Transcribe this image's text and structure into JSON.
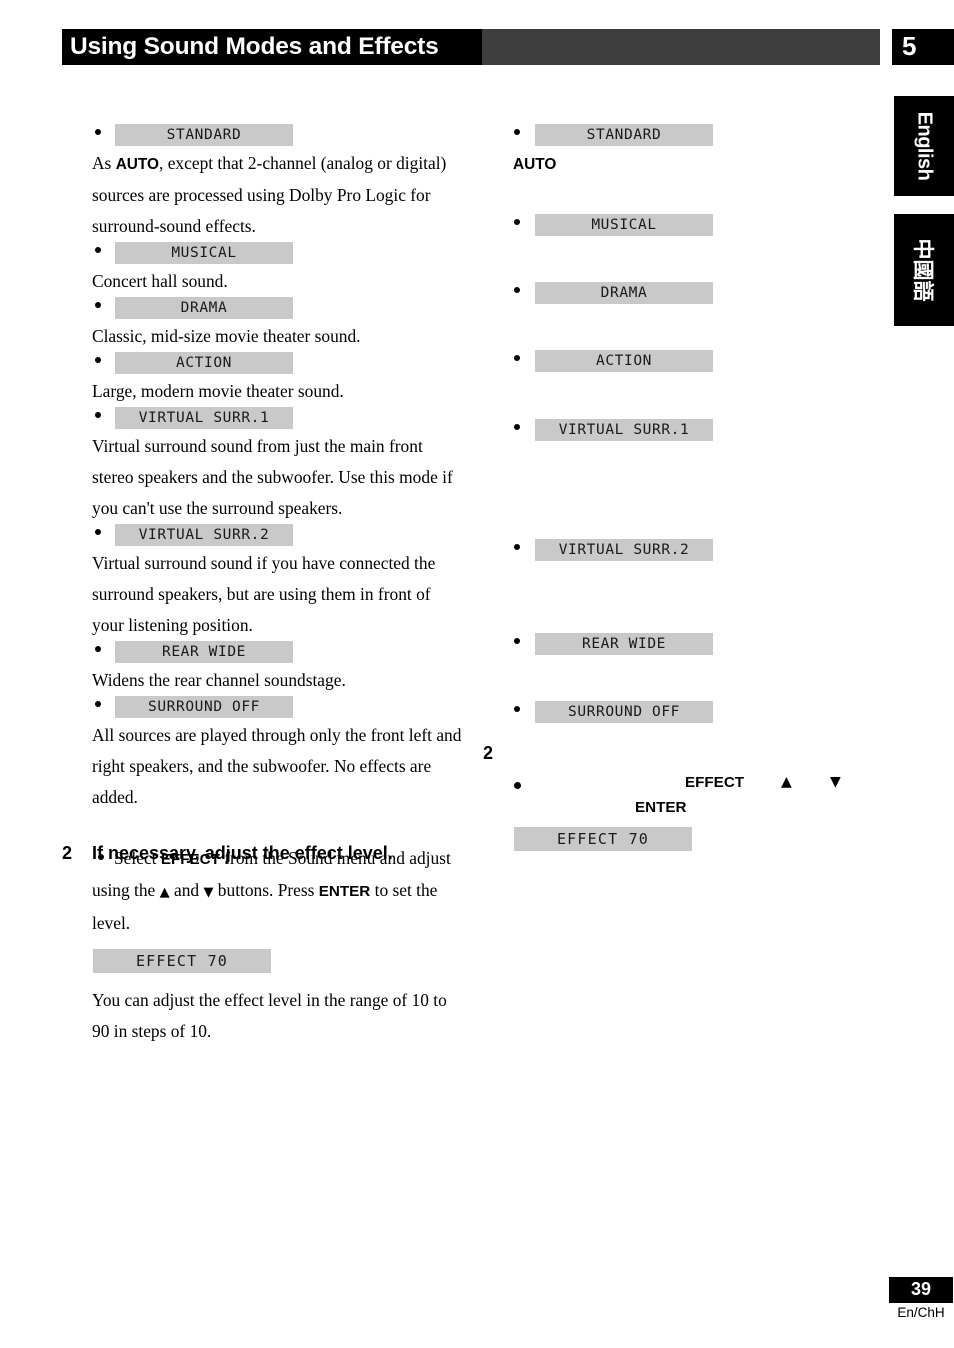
{
  "header": {
    "title": "Using Sound Modes and Effects",
    "chapter_number": "5"
  },
  "side_tabs": [
    {
      "label": "English"
    },
    {
      "label": "中國語"
    }
  ],
  "left_column": {
    "modes": [
      {
        "box_label": "STANDARD",
        "description_html": "As <b>AUTO</b>, except that 2-channel (analog or digital) sources are processed using Dolby Pro Logic for surround-sound effects."
      },
      {
        "box_label": "MUSICAL",
        "description_html": "Concert hall sound."
      },
      {
        "box_label": "DRAMA",
        "description_html": "Classic, mid-size movie theater sound."
      },
      {
        "box_label": "ACTION",
        "description_html": "Large, modern movie theater sound."
      },
      {
        "box_label": "VIRTUAL SURR.1",
        "description_html": "Virtual surround sound from just the main front stereo speakers and the subwoofer. Use this mode if you can't use the surround speakers."
      },
      {
        "box_label": "VIRTUAL SURR.2",
        "description_html": "Virtual surround sound if you have connected the surround speakers, but are using them in front of your listening position."
      },
      {
        "box_label": "REAR WIDE",
        "description_html": "Widens the rear channel soundstage."
      },
      {
        "box_label": "SURROUND OFF",
        "description_html": "All sources are played through only the front left and right speakers, and the subwoofer. No effects are added."
      }
    ],
    "step": {
      "number": "2",
      "heading": "If necessary, adjust the effect level.",
      "body_html": "Select <b>EFFECT</b> from the Sound menu and adjust using the <span class=\"arrow-glyph\">▲</span> and <span class=\"arrow-glyph\">▼</span> buttons. Press <b>ENTER</b> to set the level.",
      "effect_box_label": "EFFECT  70",
      "note": "You can adjust the effect level in the range of 10 to 90 in steps of 10."
    }
  },
  "right_column": {
    "modes": [
      {
        "box_label": "STANDARD",
        "extra_bold": "AUTO"
      },
      {
        "box_label": "MUSICAL",
        "extra_bold": ""
      },
      {
        "box_label": "DRAMA",
        "extra_bold": ""
      },
      {
        "box_label": "ACTION",
        "extra_bold": ""
      },
      {
        "box_label": "VIRTUAL SURR.1",
        "extra_bold": ""
      },
      {
        "box_label": "VIRTUAL SURR.2",
        "extra_bold": ""
      },
      {
        "box_label": "REAR WIDE",
        "extra_bold": ""
      },
      {
        "box_label": "SURROUND OFF",
        "extra_bold": ""
      }
    ],
    "step": {
      "number": "2",
      "effect_word": "EFFECT",
      "up_arrow": "▲",
      "down_arrow": "▼",
      "enter_word": "ENTER",
      "effect_box_label": "EFFECT  70"
    }
  },
  "footer": {
    "page_number": "39",
    "edition": "En/ChH"
  },
  "colors": {
    "box_gray": "#c9c9c9",
    "header_gray": "#3e3e3e",
    "black": "#000000"
  }
}
